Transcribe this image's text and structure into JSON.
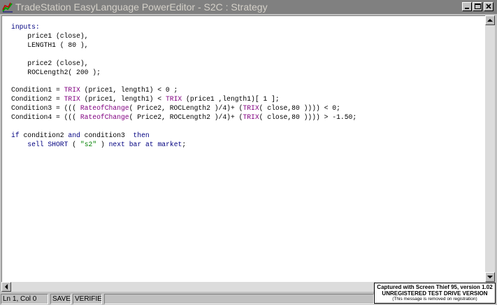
{
  "window": {
    "title": "TradeStation EasyLanguage PowerEditor - S2C : Strategy",
    "icon": "tradestation-app-icon",
    "controls": [
      "minimize-icon",
      "maximize-icon",
      "close-icon"
    ]
  },
  "editor": {
    "lines": [
      [
        {
          "t": "inputs:",
          "c": "kw"
        }
      ],
      [
        {
          "t": "    price1 (close),",
          "c": ""
        }
      ],
      [
        {
          "t": "    LENGTH1 ( 80 ),",
          "c": ""
        }
      ],
      [
        {
          "t": "",
          "c": ""
        }
      ],
      [
        {
          "t": "    price2 (close),",
          "c": ""
        }
      ],
      [
        {
          "t": "    ROCLength2( 200 );",
          "c": ""
        }
      ],
      [
        {
          "t": "",
          "c": ""
        }
      ],
      [
        {
          "t": "Condition1 = ",
          "c": ""
        },
        {
          "t": "TRIX",
          "c": "fn"
        },
        {
          "t": " (price1, length1) < 0 ;",
          "c": ""
        }
      ],
      [
        {
          "t": "Condition2 = ",
          "c": ""
        },
        {
          "t": "TRIX",
          "c": "fn"
        },
        {
          "t": " (price1, length1) < ",
          "c": ""
        },
        {
          "t": "TRIX",
          "c": "fn"
        },
        {
          "t": " (price1 ,length1)[ 1 ];",
          "c": ""
        }
      ],
      [
        {
          "t": "Condition3 = ((( ",
          "c": ""
        },
        {
          "t": "RateofChange",
          "c": "fn"
        },
        {
          "t": "( Price2, ROCLength2 )/4)+ (",
          "c": ""
        },
        {
          "t": "TRIX",
          "c": "fn"
        },
        {
          "t": "( close,80 )))) < 0;",
          "c": ""
        }
      ],
      [
        {
          "t": "Condition4 = ((( ",
          "c": ""
        },
        {
          "t": "RateofChange",
          "c": "fn"
        },
        {
          "t": "( Price2, ROCLength2 )/4)+ (",
          "c": ""
        },
        {
          "t": "TRIX",
          "c": "fn"
        },
        {
          "t": "( close,80 )))) > -1.50;",
          "c": ""
        }
      ],
      [
        {
          "t": "",
          "c": ""
        }
      ],
      [
        {
          "t": "if",
          "c": "kw"
        },
        {
          "t": " condition2 ",
          "c": ""
        },
        {
          "t": "and",
          "c": "kw"
        },
        {
          "t": " condition3  ",
          "c": ""
        },
        {
          "t": "then",
          "c": "kw"
        }
      ],
      [
        {
          "t": "    ",
          "c": ""
        },
        {
          "t": "sell",
          "c": "kw"
        },
        {
          "t": " ",
          "c": ""
        },
        {
          "t": "SHORT",
          "c": "kw"
        },
        {
          "t": " ( ",
          "c": ""
        },
        {
          "t": "\"s2\"",
          "c": "str"
        },
        {
          "t": " ) ",
          "c": ""
        },
        {
          "t": "next",
          "c": "kw"
        },
        {
          "t": " ",
          "c": ""
        },
        {
          "t": "bar",
          "c": "kw"
        },
        {
          "t": " ",
          "c": ""
        },
        {
          "t": "at",
          "c": "kw"
        },
        {
          "t": " ",
          "c": ""
        },
        {
          "t": "market",
          "c": "kw"
        },
        {
          "t": ";",
          "c": ""
        }
      ]
    ]
  },
  "statusbar": {
    "position": "Ln 1, Col 0",
    "saved": "SAVEI",
    "verified": "VERIFIEI"
  },
  "watermark": {
    "line1": "Captured with Screen Thief 95, version 1.02",
    "line2": "UNREGISTERED TEST DRIVE VERSION",
    "line3": "(This message is removed on registration)"
  },
  "colors": {
    "keyword": "#000080",
    "function": "#800080",
    "string": "#008000",
    "titlebar_inactive": "#808080"
  }
}
